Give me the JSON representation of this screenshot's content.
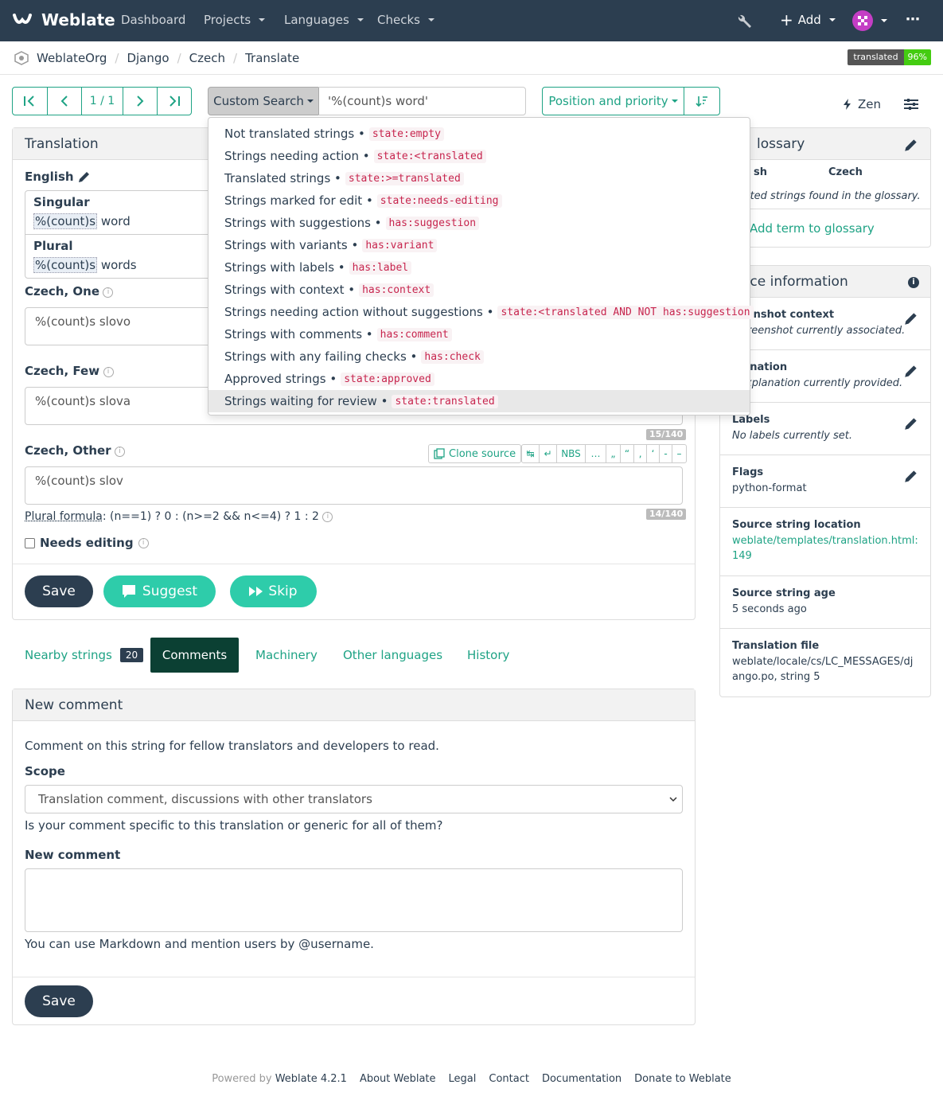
{
  "nav": {
    "brand": "Weblate",
    "items": [
      "Dashboard",
      "Projects",
      "Languages",
      "Checks"
    ],
    "add_label": "Add"
  },
  "breadcrumb": [
    "WeblateOrg",
    "Django",
    "Czech",
    "Translate"
  ],
  "badge": {
    "label": "translated",
    "value": "96%"
  },
  "pager": {
    "position": "1 / 1"
  },
  "search": {
    "button_label": "Custom Search",
    "query": "'%(count)s word'"
  },
  "sort": {
    "label": "Position and priority"
  },
  "zen": {
    "label": "Zen"
  },
  "dropdown": [
    {
      "label": "Not translated strings •",
      "code": "state:empty"
    },
    {
      "label": "Strings needing action •",
      "code": "state:<translated"
    },
    {
      "label": "Translated strings •",
      "code": "state:>=translated"
    },
    {
      "label": "Strings marked for edit •",
      "code": "state:needs-editing"
    },
    {
      "label": "Strings with suggestions •",
      "code": "has:suggestion"
    },
    {
      "label": "Strings with variants •",
      "code": "has:variant"
    },
    {
      "label": "Strings with labels •",
      "code": "has:label"
    },
    {
      "label": "Strings with context •",
      "code": "has:context"
    },
    {
      "label": "Strings needing action without suggestions •",
      "code": "state:<translated AND NOT has:suggestion"
    },
    {
      "label": "Strings with comments •",
      "code": "has:comment"
    },
    {
      "label": "Strings with any failing checks •",
      "code": "has:check"
    },
    {
      "label": "Approved strings •",
      "code": "state:approved"
    },
    {
      "label": "Strings waiting for review •",
      "code": "state:translated"
    }
  ],
  "translation": {
    "heading": "Translation",
    "source_lang": "English",
    "singular_label": "Singular",
    "singular_placeable": "%(count)s",
    "singular_rest": " word",
    "plural_label": "Plural",
    "plural_placeable": "%(count)s",
    "plural_rest": " words",
    "one_label": "Czech, One",
    "one_value": "%(count)s slovo",
    "few_label": "Czech, Few",
    "few_value": "%(count)s slova",
    "few_counter": "15/140",
    "other_label": "Czech, Other",
    "other_value": "%(count)s slov",
    "other_counter": "14/140",
    "clone_source": "Clone source",
    "special_chars": [
      "↹",
      "↵",
      "NBS",
      "…",
      "„",
      "“",
      "‚",
      "‘",
      "-",
      "–"
    ],
    "plural_formula_label": "Plural formula",
    "plural_formula": ": (n==1) ? 0 : (n>=2 && n<=4) ? 1 : 2",
    "needs_editing": "Needs editing",
    "save": "Save",
    "suggest": "Suggest",
    "skip": "Skip"
  },
  "tabs": {
    "nearby": "Nearby strings",
    "nearby_count": "20",
    "comments": "Comments",
    "machinery": "Machinery",
    "other_languages": "Other languages",
    "history": "History"
  },
  "comment": {
    "heading": "New comment",
    "intro": "Comment on this string for fellow translators and developers to read.",
    "scope_label": "Scope",
    "scope_value": "Translation comment, discussions with other translators",
    "scope_help": "Is your comment specific to this translation or generic for all of them?",
    "new_comment_label": "New comment",
    "markdown_help": "You can use Markdown and mention users by @username.",
    "save": "Save"
  },
  "glossary": {
    "heading": "lossary",
    "col_source": "sh",
    "col_target": "Czech",
    "empty": "lated strings found in the glossary.",
    "add": "Add term to glossary"
  },
  "source_info": {
    "heading": "urce information",
    "rows": [
      {
        "title": "eenshot context",
        "value": "screenshot currently associated.",
        "italic": true,
        "edit": true
      },
      {
        "title": "lanation",
        "value": "explanation currently provided.",
        "italic": true,
        "edit": true
      },
      {
        "title": "Labels",
        "value": "No labels currently set.",
        "italic": true,
        "edit": true
      },
      {
        "title": "Flags",
        "value": "python-format",
        "italic": false,
        "edit": true
      },
      {
        "title": "Source string location",
        "value": "weblate/templates/translation.html:149",
        "link": true
      },
      {
        "title": "Source string age",
        "value": "5 seconds ago"
      },
      {
        "title": "Translation file",
        "value": "weblate/locale/cs/LC_MESSAGES/django.po, string 5"
      }
    ]
  },
  "footer": {
    "powered": "Powered by",
    "version": "Weblate 4.2.1",
    "links": [
      "About Weblate",
      "Legal",
      "Contact",
      "Documentation",
      "Donate to Weblate"
    ]
  },
  "colors": {
    "navbar": "#2c3e50",
    "accent": "#1fa385",
    "dark_button": "#2c3e50",
    "suggest": "#2eccaa"
  }
}
